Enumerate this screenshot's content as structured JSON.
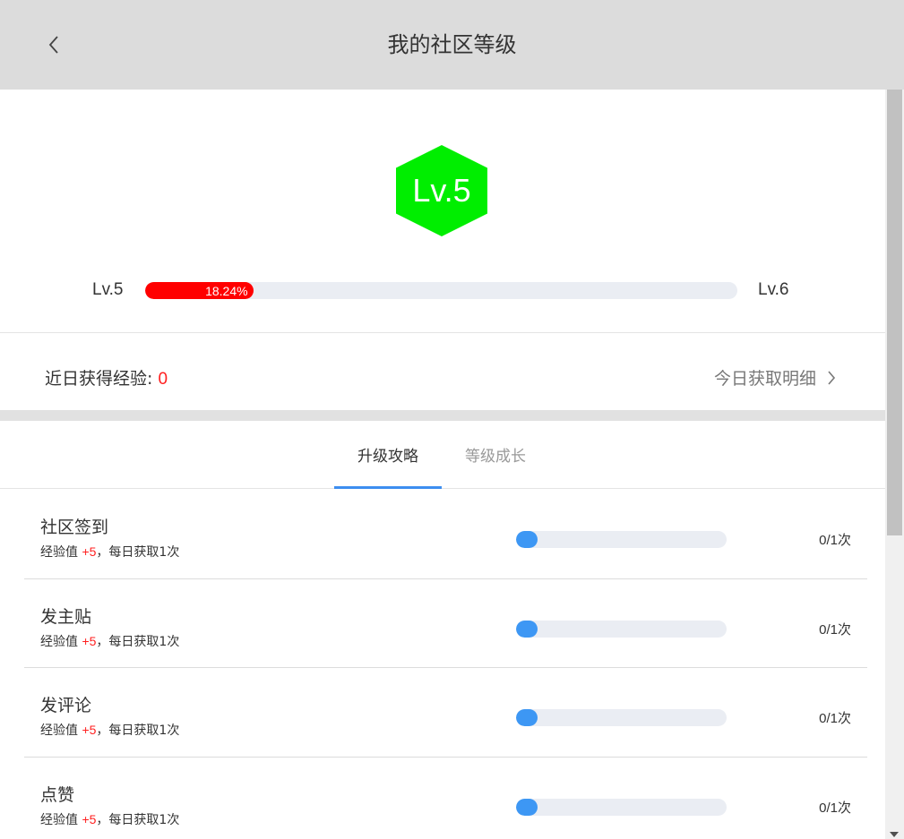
{
  "header": {
    "title": "我的社区等级",
    "back_icon": "chevron-left-icon"
  },
  "level": {
    "badge_text": "Lv.5",
    "badge_color": "#00ee00",
    "current_label": "Lv.5",
    "next_label": "Lv.6",
    "progress_percent": 18.24,
    "progress_text": "18.24%",
    "progress_color": "#ff0000"
  },
  "experience": {
    "label": "近日获得经验: ",
    "value": "0",
    "detail_link": "今日获取明细"
  },
  "tabs": [
    {
      "label": "升级攻略",
      "active": true
    },
    {
      "label": "等级成长",
      "active": false
    }
  ],
  "tasks": [
    {
      "name": "社区签到",
      "desc_prefix": "经验值 ",
      "plus": "+5",
      "desc_suffix": "，每日获取1次",
      "count": "0/1次",
      "progress": 0.1
    },
    {
      "name": "发主贴",
      "desc_prefix": "经验值 ",
      "plus": "+5",
      "desc_suffix": "，每日获取1次",
      "count": "0/1次",
      "progress": 0.1
    },
    {
      "name": "发评论",
      "desc_prefix": "经验值 ",
      "plus": "+5",
      "desc_suffix": "，每日获取1次",
      "count": "0/1次",
      "progress": 0.1
    },
    {
      "name": "点赞",
      "desc_prefix": "经验值 ",
      "plus": "+5",
      "desc_suffix": "，每日获取1次",
      "count": "0/1次",
      "progress": 0.1
    }
  ],
  "colors": {
    "accent": "#3d8ef0",
    "task_fill": "#3d97f4",
    "highlight": "#ff1f1f"
  }
}
